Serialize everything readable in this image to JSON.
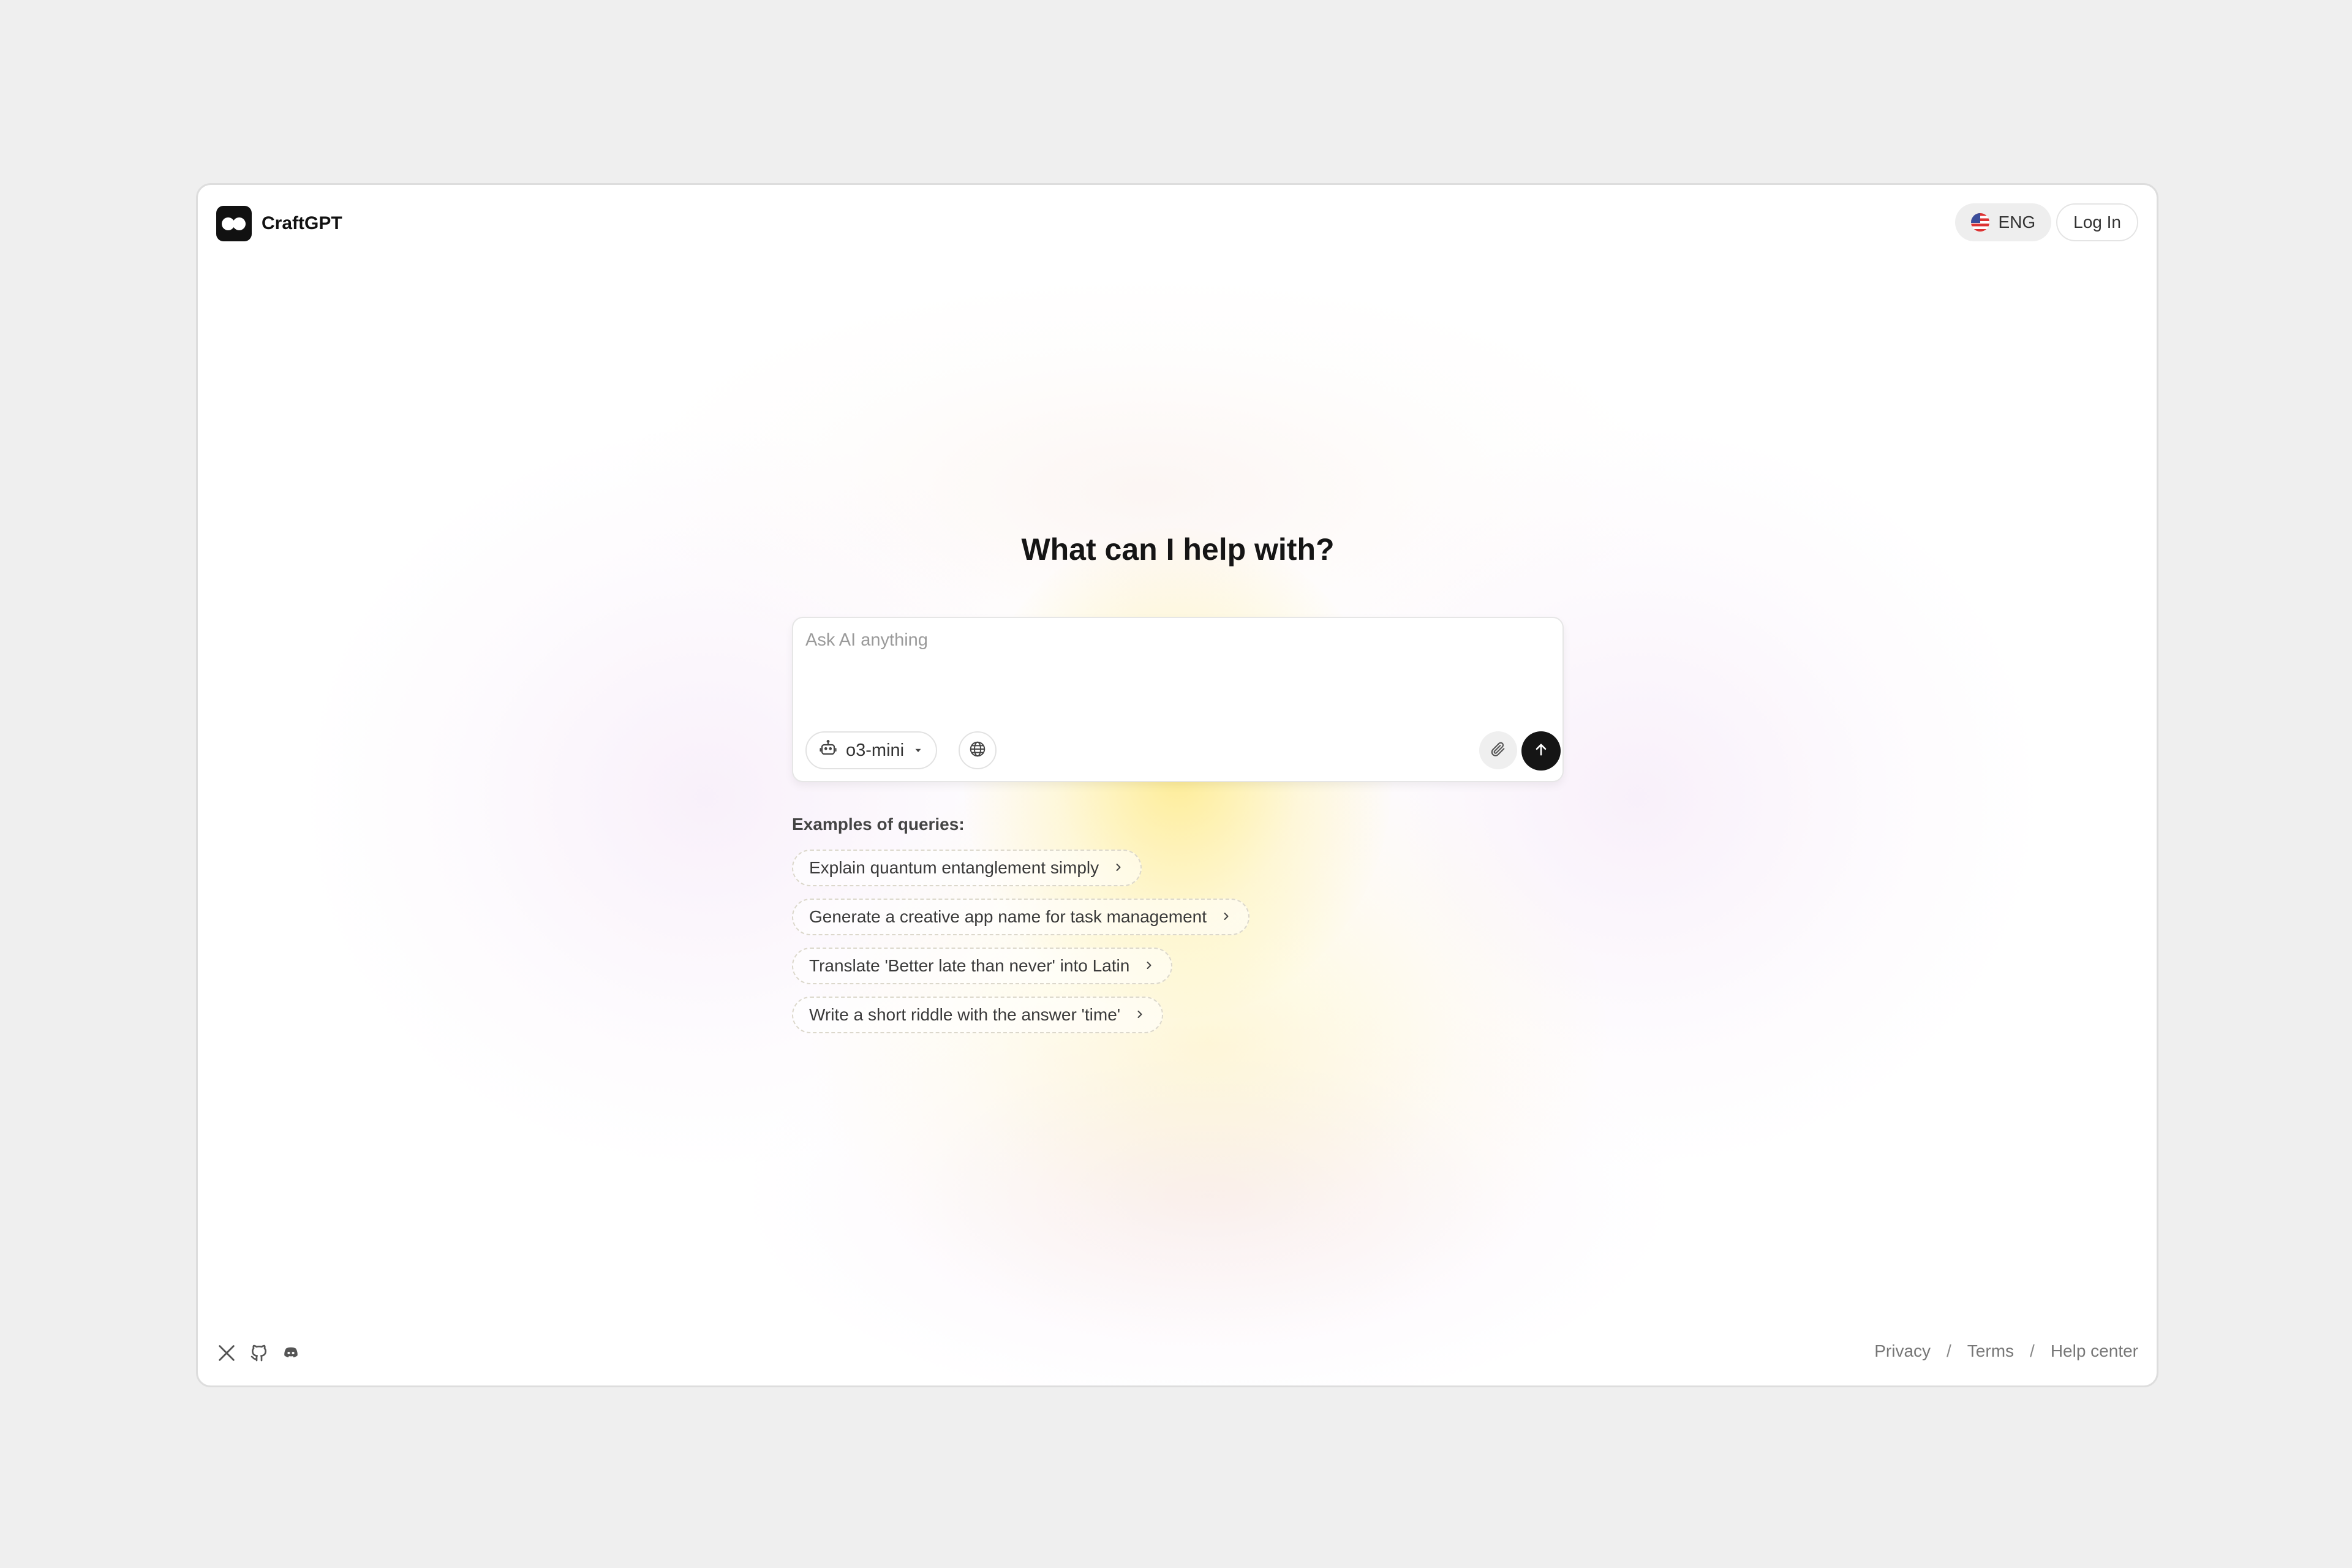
{
  "header": {
    "brand_name": "CraftGPT",
    "language_label": "ENG",
    "login_label": "Log In"
  },
  "main": {
    "heading": "What can I help with?",
    "composer": {
      "placeholder": "Ask AI anything",
      "value": "",
      "model_label": "o3-mini"
    },
    "examples_label": "Examples of queries:",
    "examples": [
      "Explain quantum entanglement simply",
      "Generate a creative app name for task management",
      "Translate 'Better late than never' into Latin",
      "Write a short riddle with the answer 'time'"
    ]
  },
  "footer": {
    "social_icons": [
      "x-icon",
      "github-icon",
      "discord-icon"
    ],
    "links": [
      "Privacy",
      "Terms",
      "Help center"
    ],
    "separator": "/"
  },
  "colors": {
    "background": "#efefef",
    "card": "#ffffff",
    "accent_dark": "#151515",
    "glow_yellow": "#fcde46",
    "glow_pink": "#f3e4f6"
  }
}
